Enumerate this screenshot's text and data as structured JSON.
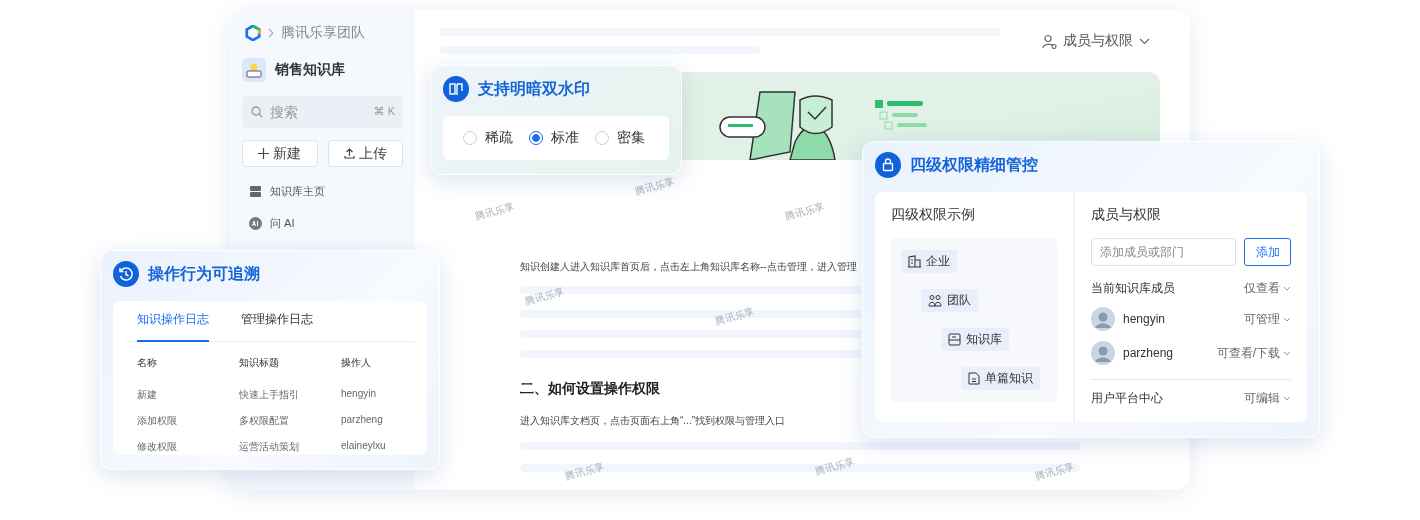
{
  "sidebar": {
    "team": "腾讯乐享团队",
    "kb_name": "销售知识库",
    "search": {
      "placeholder": "搜索",
      "shortcut": "⌘ K"
    },
    "buttons": [
      {
        "label": "新建",
        "kind": "new"
      },
      {
        "label": "上传",
        "kind": "upload"
      }
    ],
    "nav": [
      {
        "label": "知识库主页",
        "kind": "home"
      },
      {
        "label": "问 AI",
        "kind": "ai"
      }
    ]
  },
  "doc": {
    "members_menu": "成员与权限",
    "paragraph": "知识创建人进入知识库首页后，点击左上角知识库名称--点击管理，进入管理",
    "heading": "二、如何设置操作权限",
    "paragraph_2": "进入知识库文档页，点击页面右上角“...”找到权限与管理入口",
    "watermarks": [
      "腾讯乐享",
      "腾讯乐享",
      "腾讯乐享",
      "腾讯乐享",
      "腾讯乐享",
      "腾讯乐享",
      "腾讯乐享",
      "腾讯乐享"
    ]
  },
  "watermark_card": {
    "title": "支持明暗双水印",
    "options": [
      {
        "label": "稀疏",
        "selected": false
      },
      {
        "label": "标准",
        "selected": true
      },
      {
        "label": "密集",
        "selected": false
      }
    ]
  },
  "log_card": {
    "title": "操作行为可追溯",
    "tabs": [
      {
        "label": "知识操作日志",
        "selected": true
      },
      {
        "label": "管理操作日志",
        "selected": false
      }
    ],
    "columns": [
      "名称",
      "知识标题",
      "操作人"
    ],
    "rows": [
      [
        "新建",
        "快速上手指引",
        "hengyin"
      ],
      [
        "添加权限",
        "多权限配置",
        "parzheng"
      ],
      [
        "修改权限",
        "运营活动策划",
        "elaineylxu"
      ]
    ]
  },
  "permission_card": {
    "title": "四级权限精细管控",
    "example_title": "四级权限示例",
    "tree": {
      "label": "企业",
      "kind": "company",
      "children": [
        {
          "label": "团队",
          "kind": "team",
          "children": [
            {
              "label": "知识库",
              "kind": "kb",
              "children": [
                {
                  "label": "单篇知识",
                  "kind": "doc"
                }
              ]
            }
          ]
        }
      ]
    },
    "members_title": "成员与权限",
    "add_field": {
      "placeholder": "添加成员或部门"
    },
    "add_button": "添加",
    "group": {
      "label": "当前知识库成员",
      "permission": "仅查看"
    },
    "members": [
      {
        "name": "hengyin",
        "permission": "可管理"
      },
      {
        "name": "parzheng",
        "permission": "可查看/下载"
      }
    ],
    "platform": {
      "label": "用户平台中心",
      "permission": "可编辑"
    }
  }
}
